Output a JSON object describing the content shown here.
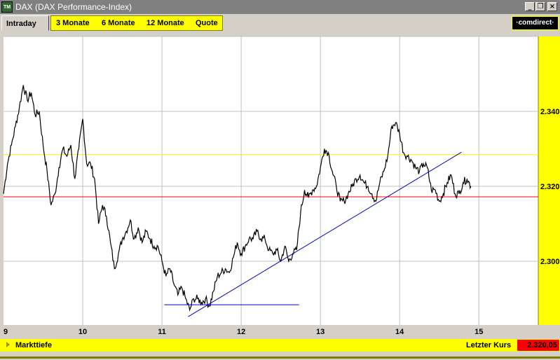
{
  "window": {
    "app_icon_label": "TM",
    "title": "DAX (DAX Performance-Index)",
    "buttons": {
      "minimize": "_",
      "restore": "❐",
      "close": "×"
    }
  },
  "tabs": {
    "active": "Intraday",
    "items": [
      "3 Monate",
      "6 Monate",
      "12 Monate",
      "Quote"
    ]
  },
  "brand": "·comdirect·",
  "chart_data": {
    "type": "line",
    "x_ticks": [
      "9",
      "10",
      "11",
      "12",
      "13",
      "14",
      "15"
    ],
    "y_ticks": [
      "2.300",
      "2.320",
      "2.340"
    ],
    "xlim": [
      9,
      15.75
    ],
    "ylim": [
      2283,
      2360
    ],
    "grid": true,
    "colors": {
      "price": "#000000",
      "plot_bg": "#ffffff",
      "grid": "#c0c0c0",
      "yellow_level": "#ffff00",
      "red_level": "#ff0000",
      "trendline": "#0000c0",
      "axis_bg": "#ffff00"
    },
    "series": [
      {
        "x": [
          9.0,
          9.05,
          9.1,
          9.15,
          9.2,
          9.25,
          9.3,
          9.35,
          9.4,
          9.45,
          9.5,
          9.55,
          9.6,
          9.65,
          9.7,
          9.75,
          9.8,
          9.85,
          9.9,
          9.95,
          10.0,
          10.05,
          10.1,
          10.15,
          10.2,
          10.25,
          10.3,
          10.35,
          10.4,
          10.45,
          10.5,
          10.55,
          10.6,
          10.65,
          10.7,
          10.75,
          10.8,
          10.85,
          10.9,
          10.95,
          11.0,
          11.05,
          11.1,
          11.15,
          11.2,
          11.25,
          11.3,
          11.35,
          11.4,
          11.45,
          11.5,
          11.55,
          11.6,
          11.65,
          11.7,
          11.75,
          11.8,
          11.85,
          11.9,
          11.95,
          12.0,
          12.05,
          12.1,
          12.15,
          12.2,
          12.25,
          12.3,
          12.35,
          12.4,
          12.45,
          12.5,
          12.55,
          12.6,
          12.65,
          12.7,
          12.75,
          12.8,
          12.85,
          12.9,
          12.95,
          13.0,
          13.05,
          13.1,
          13.15,
          13.2,
          13.25,
          13.3,
          13.35,
          13.4,
          13.45,
          13.5,
          13.55,
          13.6,
          13.65,
          13.7,
          13.75,
          13.8,
          13.85,
          13.9,
          13.95,
          14.0,
          14.05,
          14.1,
          14.15,
          14.2,
          14.25,
          14.3,
          14.35,
          14.4,
          14.45,
          14.5,
          14.55,
          14.6,
          14.65,
          14.7,
          14.75,
          14.8,
          14.85,
          14.9
        ],
        "y": [
          2318,
          2326,
          2331,
          2336,
          2341,
          2347,
          2343,
          2345,
          2339,
          2340,
          2331,
          2324,
          2315,
          2318,
          2325,
          2330,
          2328,
          2331,
          2322,
          2330,
          2338,
          2326,
          2326,
          2322,
          2310,
          2315,
          2312,
          2305,
          2298,
          2302,
          2306,
          2308,
          2311,
          2306,
          2309,
          2305,
          2308,
          2306,
          2304,
          2304,
          2300,
          2296,
          2298,
          2294,
          2291,
          2293,
          2290,
          2287,
          2290,
          2290,
          2289,
          2290,
          2288,
          2292,
          2296,
          2297,
          2298,
          2297,
          2301,
          2305,
          2302,
          2304,
          2306,
          2306,
          2308,
          2306,
          2306,
          2303,
          2302,
          2303,
          2300,
          2304,
          2300,
          2302,
          2303,
          2313,
          2319,
          2317,
          2319,
          2320,
          2325,
          2330,
          2329,
          2324,
          2320,
          2316,
          2316,
          2318,
          2320,
          2322,
          2323,
          2321,
          2320,
          2318,
          2316,
          2321,
          2324,
          2328,
          2336,
          2337,
          2334,
          2329,
          2328,
          2327,
          2325,
          2324,
          2326,
          2325,
          2319,
          2319,
          2316,
          2318,
          2321,
          2323,
          2318,
          2318,
          2321,
          2322,
          2320
        ]
      }
    ],
    "reference_lines": {
      "yellow": 2328.5,
      "red": 2317.2
    },
    "trendlines": [
      {
        "x": [
          11.33,
          14.78
        ],
        "y": [
          2285.2,
          2329.1
        ]
      },
      {
        "x": [
          11.03,
          12.73
        ],
        "y": [
          2288.4,
          2288.4
        ]
      }
    ]
  },
  "footer": {
    "left_label": "Markttiefe",
    "right_label": "Letzter Kurs",
    "value": "2.320,05"
  }
}
